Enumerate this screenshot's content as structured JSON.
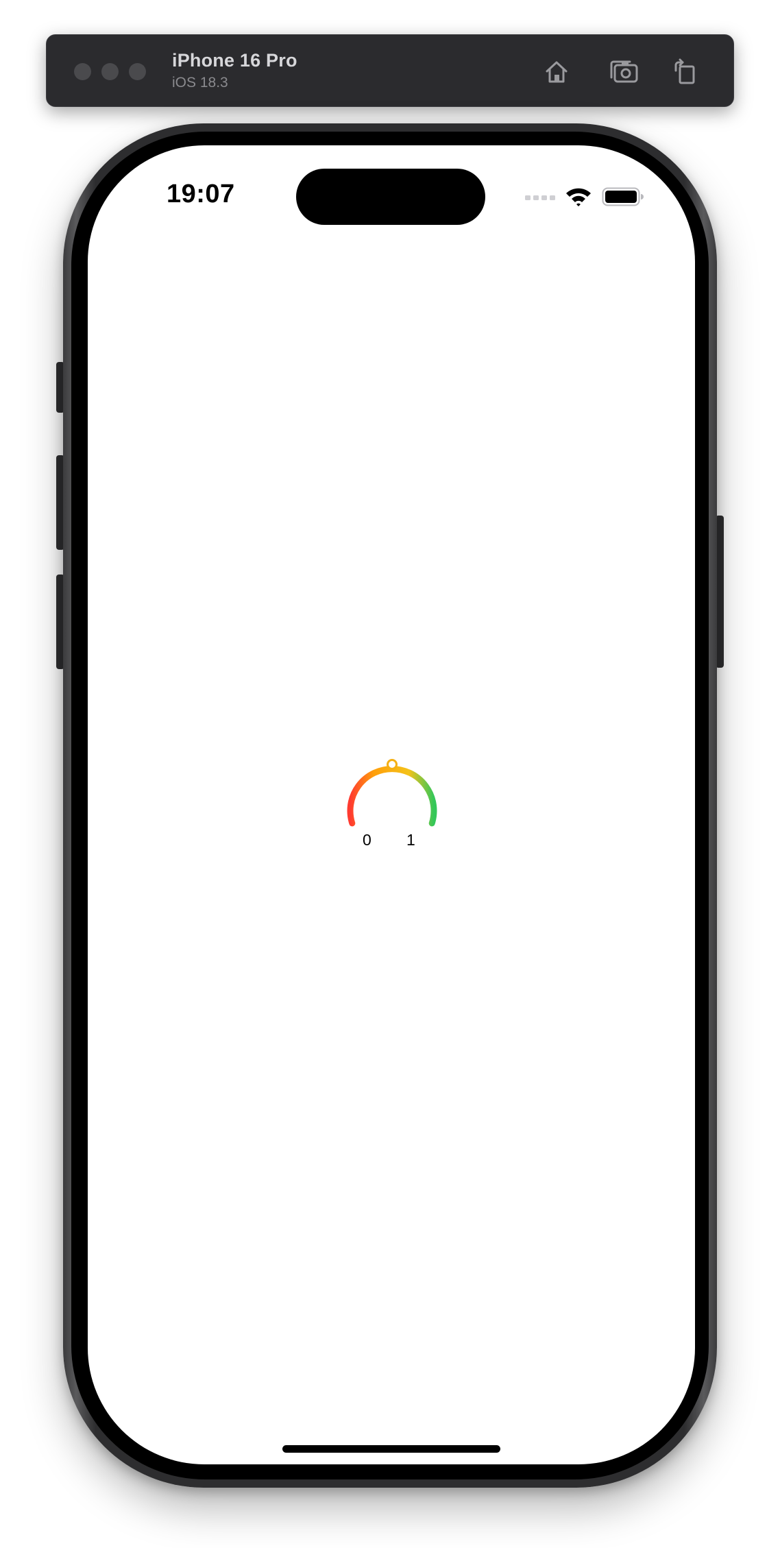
{
  "simulator": {
    "device_name": "iPhone 16 Pro",
    "os_version": "iOS 18.3",
    "buttons": {
      "home": "home-icon",
      "screenshot": "camera-icon",
      "rotate": "rotate-icon"
    }
  },
  "status_bar": {
    "time": "19:07",
    "icons": [
      "cellular-icon",
      "wifi-icon",
      "battery-icon"
    ]
  },
  "gauge": {
    "value": 0.5,
    "min_label": "0",
    "max_label": "1",
    "colors": {
      "start": "#ff3b30",
      "mid": "#ff9f0a",
      "upper": "#f4c21a",
      "end": "#34c759"
    }
  }
}
